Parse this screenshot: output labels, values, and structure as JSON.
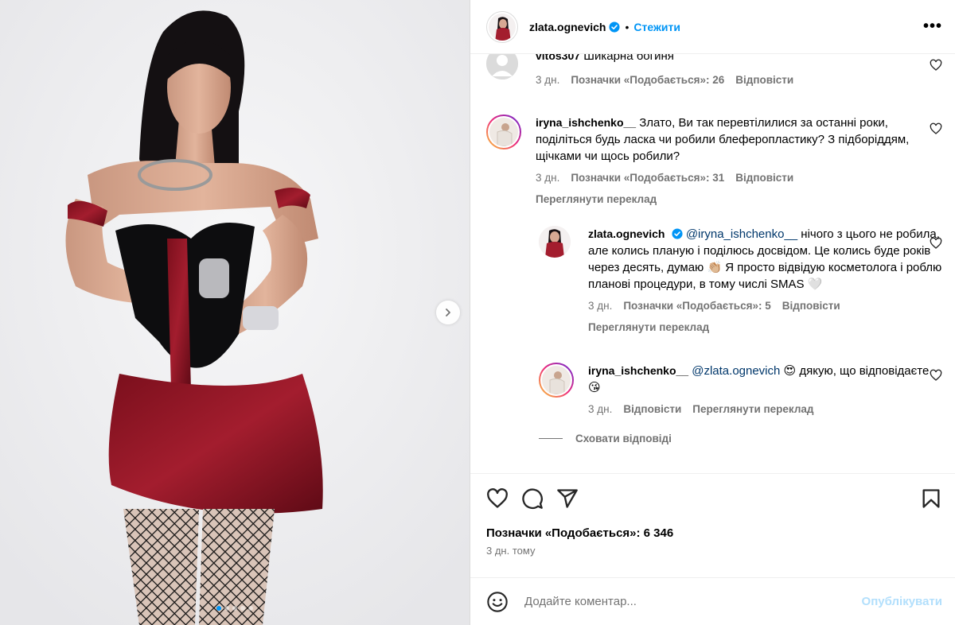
{
  "post": {
    "author": "zlata.ognevich",
    "follow_label": "Стежити",
    "separator": "•",
    "more_label": "•••",
    "carousel_count": 5,
    "carousel_active": 0
  },
  "comments": [
    {
      "username": "vitos307",
      "text": "Шикарна богиня",
      "time": "3 дн.",
      "likes": "Позначки «Подобається»: 26",
      "reply": "Відповісти"
    },
    {
      "username": "iryna_ishchenko__",
      "text": "Злато, Ви так перевтілилися за останні роки, поділіться будь ласка чи робили блеферопластику? З підборіддям, щічками чи щось робили?",
      "time": "3 дн.",
      "likes": "Позначки «Подобається»: 31",
      "reply": "Відповісти",
      "translate": "Переглянути переклад"
    }
  ],
  "replies": [
    {
      "username": "zlata.ognevich",
      "mention": "@iryna_ishchenko__",
      "text": " нічого з цього не робила, але колись планую і поділюсь досвідом. Це колись буде років через десять, думаю 👏🏼 Я просто відвідую косметолога і роблю планові процедури, в тому числі SMAS 🤍",
      "time": "3 дн.",
      "likes": "Позначки «Подобається»: 5",
      "reply": "Відповісти",
      "translate": "Переглянути переклад"
    },
    {
      "username": "iryna_ishchenko__",
      "mention": "@zlata.ognevich",
      "text": " 😍 дякую, що відповідаєте 😘",
      "time": "3 дн.",
      "reply": "Відповісти",
      "translate": "Переглянути переклад"
    }
  ],
  "hide_replies": "Сховати відповіді",
  "likes_total": "Позначки «Подобається»: 6 346",
  "posted_ago": "3 дн. тому",
  "comment_input": {
    "placeholder": "Додайте коментар...",
    "publish_label": "Опублікувати"
  },
  "colors": {
    "accent": "#0095f6",
    "link": "#00376b",
    "muted": "#737373",
    "publish_disabled": "#b2dffc"
  }
}
